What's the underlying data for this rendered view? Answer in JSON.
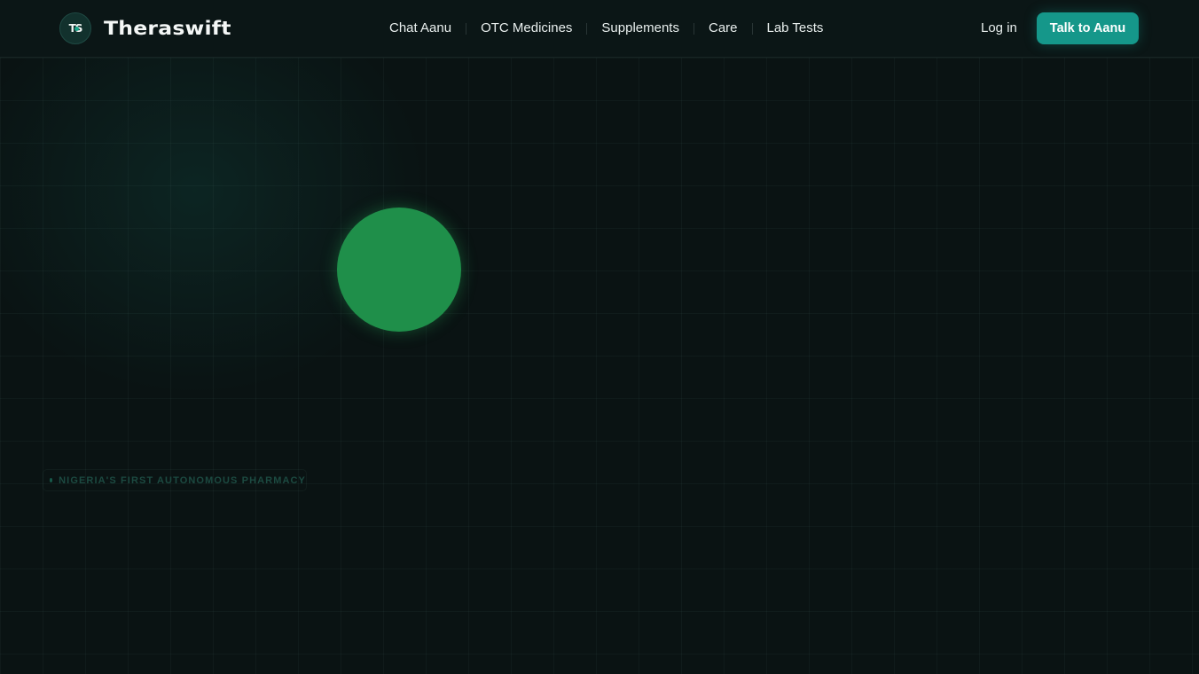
{
  "header": {
    "brand": {
      "mark_text": "TS",
      "name": "Theraswift"
    },
    "nav": [
      {
        "label": "Chat Aanu"
      },
      {
        "label": "OTC Medicines"
      },
      {
        "label": "Supplements"
      },
      {
        "label": "Care"
      },
      {
        "label": "Lab Tests"
      }
    ],
    "login_label": "Log in",
    "cta_label": "Talk to Aanu"
  },
  "hero": {
    "badge_text": "NIGERIA'S FIRST AUTONOMOUS PHARMACY",
    "orb_color": "#1f8f4a"
  },
  "colors": {
    "background": "#0a1313",
    "accent": "#15978a",
    "text": "#e8eeed"
  }
}
